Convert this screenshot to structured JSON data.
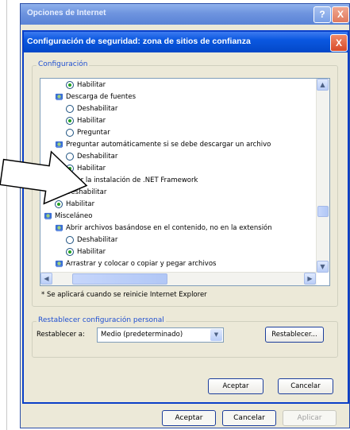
{
  "outer": {
    "title": "Opciones de Internet",
    "help": "?",
    "close": "X",
    "buttons": {
      "ok": "Aceptar",
      "cancel": "Cancelar",
      "apply": "Aplicar"
    }
  },
  "dialog": {
    "title": "Configuración de seguridad: zona de sitios de confianza",
    "close": "X",
    "settings_legend": "Configuración",
    "tree": [
      {
        "kind": "radio",
        "label": "Habilitar",
        "checked": true,
        "indent": 2
      },
      {
        "kind": "header",
        "label": "Descarga de fuentes",
        "indent": 1
      },
      {
        "kind": "radio",
        "label": "Deshabilitar",
        "checked": false,
        "indent": 2
      },
      {
        "kind": "radio",
        "label": "Habilitar",
        "checked": true,
        "indent": 2
      },
      {
        "kind": "radio",
        "label": "Preguntar",
        "checked": false,
        "indent": 2
      },
      {
        "kind": "header",
        "label": "Preguntar automáticamente si se debe descargar un archivo",
        "indent": 1
      },
      {
        "kind": "radio",
        "label": "Deshabilitar",
        "checked": false,
        "indent": 2
      },
      {
        "kind": "radio",
        "label": "Habilitar",
        "checked": true,
        "indent": 2
      },
      {
        "kind": "header",
        "label": "Habilitar la instalación de .NET Framework",
        "indent": 0
      },
      {
        "kind": "radio",
        "label": "Deshabilitar",
        "checked": false,
        "indent": 1
      },
      {
        "kind": "radio",
        "label": "Habilitar",
        "checked": true,
        "indent": 1
      },
      {
        "kind": "header",
        "label": "Misceláneo",
        "indent": 0
      },
      {
        "kind": "header",
        "label": "Abrir archivos basándose en el contenido, no en la extensión",
        "indent": 1
      },
      {
        "kind": "radio",
        "label": "Deshabilitar",
        "checked": false,
        "indent": 2
      },
      {
        "kind": "radio",
        "label": "Habilitar",
        "checked": true,
        "indent": 2
      },
      {
        "kind": "header",
        "label": "Arrastrar y colocar o copiar y pegar archivos",
        "indent": 1
      }
    ],
    "note": "* Se aplicará cuando se reinicie Internet Explorer",
    "reset_legend": "Restablecer configuración personal",
    "reset_label": "Restablecer a:",
    "reset_select": "Medio (predeterminado)",
    "reset_button": "Restablecer...",
    "ok": "Aceptar",
    "cancel": "Cancelar"
  },
  "colors": {
    "title_bar": "#0a57e0",
    "legend_text": "#1f4fd1",
    "radio_dot": "#21a121"
  },
  "icons": {
    "setting": "gear-icon",
    "help": "question-icon",
    "close": "close-icon"
  }
}
